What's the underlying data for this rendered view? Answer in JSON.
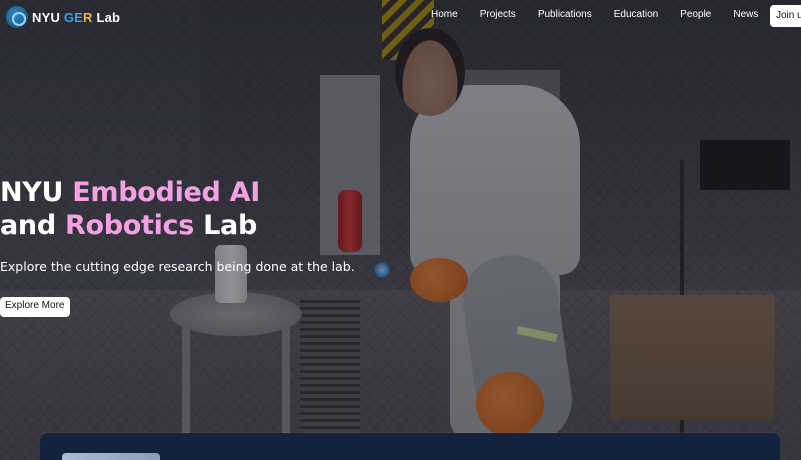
{
  "nav": {
    "logo": {
      "part1": "NYU ",
      "part2": "GE",
      "part3": "R",
      "part4": " Lab"
    },
    "links": [
      "Home",
      "Projects",
      "Publications",
      "Education",
      "People",
      "News"
    ],
    "join_label": "Join us"
  },
  "hero": {
    "title_line1_plain": "NYU ",
    "title_line1_accent": "Embodied AI",
    "title_line2_plain1": "and ",
    "title_line2_accent": "Robotics",
    "title_line2_plain2": " Lab",
    "subtitle": "Explore the cutting edge research being done at the lab.",
    "cta_label": "Explore More"
  },
  "colors": {
    "accent_pink": "#f3a1e2",
    "logo_blue": "#3da1e0",
    "bottom_card": "#13233f"
  }
}
